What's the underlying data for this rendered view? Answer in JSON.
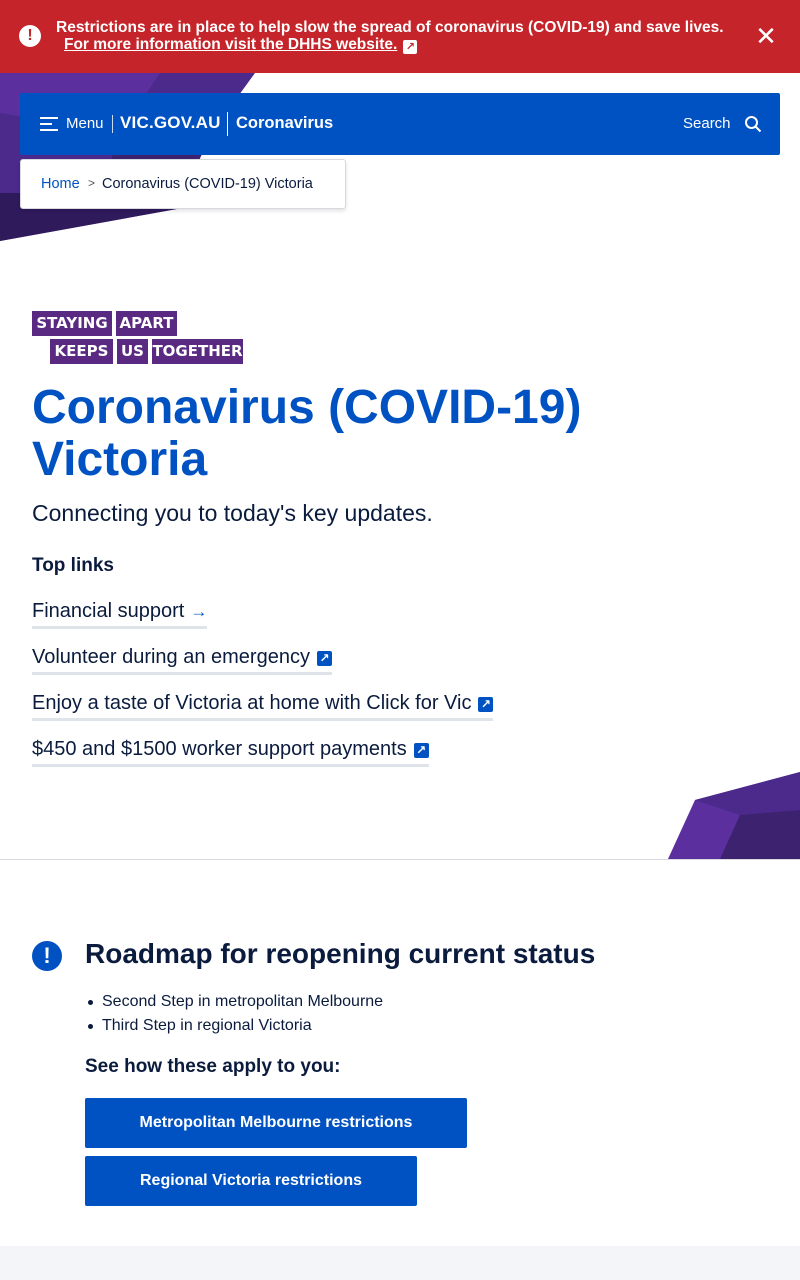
{
  "alert": {
    "icon": "exclamation-icon",
    "message": "Restrictions are in place to help slow the spread of coronavirus (COVID-19) and save lives.",
    "link_text": "For more information visit the DHHS website.",
    "close_icon": "close-icon",
    "background_color": "#c5252a"
  },
  "header": {
    "menu_label": "Menu",
    "logo_text": "VIC.GOV.AU",
    "site_name": "Coronavirus",
    "search_label": "Search",
    "background_color": "#0052c2"
  },
  "breadcrumb": {
    "home": "Home",
    "separator": ">",
    "current": "Coronavirus (COVID-19) Victoria"
  },
  "campaign_logo": {
    "words": [
      "STAYING",
      "APART",
      "KEEPS",
      "US",
      "TOGETHER"
    ],
    "color": "#5a2a82"
  },
  "page": {
    "title": "Coronavirus (COVID-19) Victoria",
    "intro": "Connecting you to today's key updates.",
    "top_links_heading": "Top links",
    "top_links": [
      {
        "label": "Financial support",
        "icon": "arrow-right-icon"
      },
      {
        "label": "Volunteer during an emergency",
        "icon": "external-link-icon"
      },
      {
        "label": "Enjoy a taste of Victoria at home with Click for Vic",
        "icon": "external-link-icon"
      },
      {
        "label": "$450 and $1500 worker support payments",
        "icon": "external-link-icon"
      }
    ]
  },
  "roadmap": {
    "icon": "exclamation-icon",
    "title": "Roadmap for reopening current status",
    "statuses": [
      "Second Step in metropolitan Melbourne",
      "Third Step in regional Victoria"
    ],
    "apply_heading": "See how these apply to you:",
    "buttons": [
      "Metropolitan Melbourne restrictions",
      "Regional Victoria restrictions"
    ]
  },
  "colors": {
    "primary": "#0052c2",
    "text": "#0a1b3d",
    "purple": "#5a2a82"
  }
}
